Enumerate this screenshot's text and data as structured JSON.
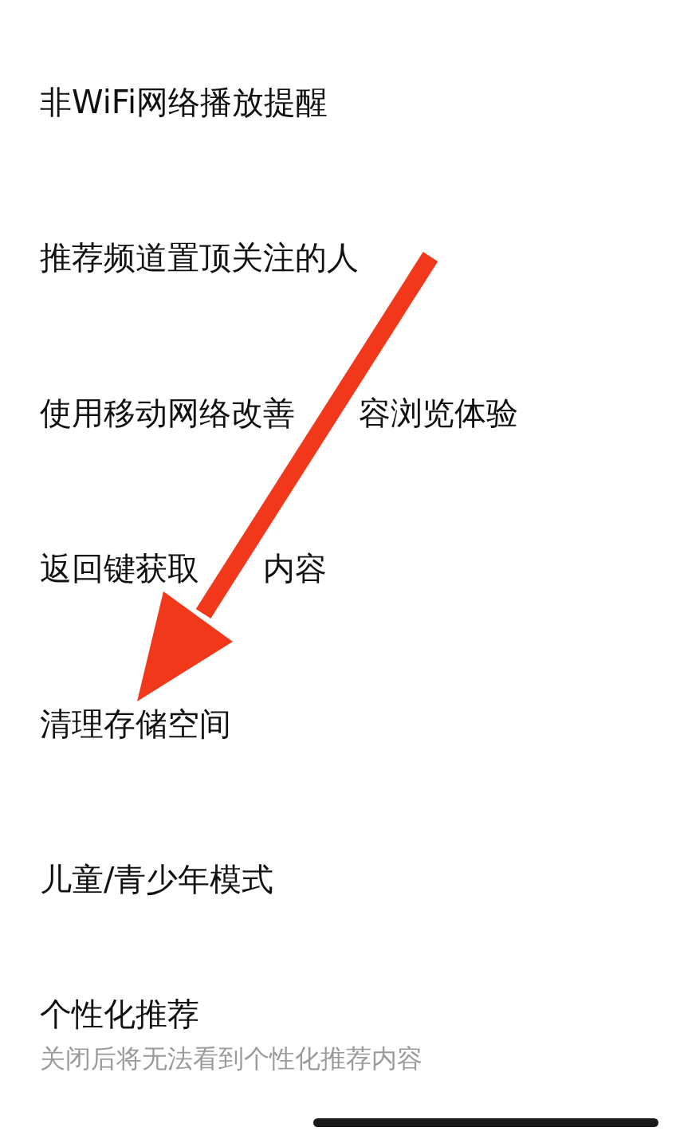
{
  "settings": [
    {
      "label": "非WiFi网络播放提醒"
    },
    {
      "label": "推荐频道置顶关注的人"
    },
    {
      "label_parts": [
        "使用移动网络改善",
        "容浏览体验"
      ]
    },
    {
      "label_parts": [
        "返回键获取",
        "内容"
      ]
    },
    {
      "label": "清理存储空间"
    },
    {
      "label": "儿童/青少年模式"
    },
    {
      "label": "个性化推荐",
      "description": "关闭后将无法看到个性化推荐内容"
    }
  ]
}
